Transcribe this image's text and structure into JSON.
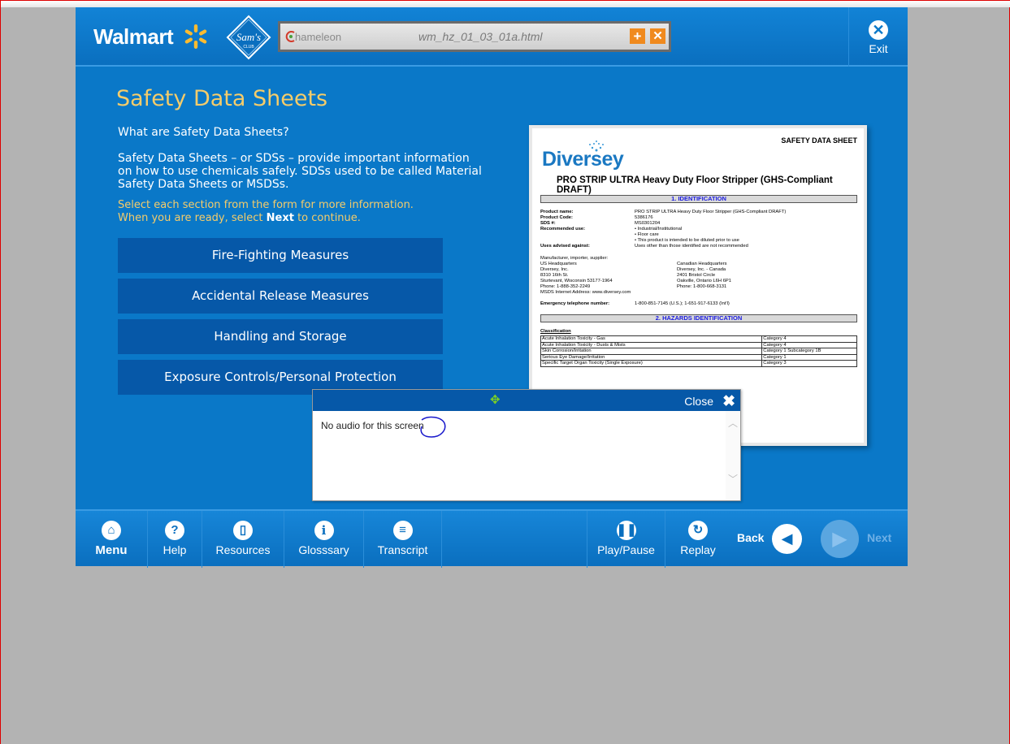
{
  "header": {
    "walmart": "Walmart",
    "sams": "Sam's",
    "sams_sub": "CLUB",
    "chameleon": "hameleon",
    "filename": "wm_hz_01_03_01a.html",
    "exit_label": "Exit"
  },
  "content": {
    "title": "Safety Data Sheets",
    "question": "What are Safety Data Sheets?",
    "intro": "Safety Data Sheets – or SDSs – provide important information on how to use chemicals safely.  SDSs used to be called Material Safety Data Sheets or MSDSs.",
    "instr_line1": "Select each section from the form for more information.",
    "instr_line2_pre": "When you are ready, select ",
    "instr_next": "Next",
    "instr_line2_post": " to continue.",
    "sections": [
      "Fire-Fighting Measures",
      "Accidental Release Measures",
      "Handling and Storage",
      "Exposure Controls/Personal Protection"
    ]
  },
  "sds": {
    "header": "SAFETY DATA SHEET",
    "brand": "Diversey",
    "product": "PRO STRIP ULTRA Heavy Duty Floor Stripper (GHS-Compliant DRAFT)",
    "section1": "1. IDENTIFICATION",
    "ident_labels": "Product name:\nProduct Code:\nSDS #:\nRecommended use:\n\n\nUses advised against:",
    "ident_values": "PRO STRIP ULTRA Heavy Duty Floor Stripper (GHS-Compliant DRAFT)\n5386176\nMS0301204\n• Industrial/Institutional\n• Floor care\n• This product is intended to be diluted prior to use\nUses other than those identified are not recommended",
    "us_hq": "Manufacturer, importer, supplier:\nUS Headquarters\nDiversey, Inc.\n8310 16th St.\nSturtevant, Wisconsin 53177-1964\nPhone: 1-888-352-2249\nMSDS Internet Address: www.diversey.com",
    "ca_hq": "\nCanadian Headquarters\nDiversey, Inc. - Canada\n2401 Bristol Circle\nOakville, Ontario L6H 6P1\nPhone: 1-800-668-3131",
    "emergency_label": "Emergency telephone number:",
    "emergency_value": "1-800-851-7145 (U.S.); 1-651-917-6133 (Int'l)",
    "section2": "2. HAZARDS IDENTIFICATION",
    "classification": "Classification",
    "hazards": [
      {
        "name": "Acute Inhalation Toxicity - Gas",
        "cat": "Category 4"
      },
      {
        "name": "Acute Inhalation Toxicity - Dusts & Mists",
        "cat": "Category 4"
      },
      {
        "name": "Skin Corrosion/Irritation",
        "cat": "Category 1 Subcategory 1B"
      },
      {
        "name": "Serious Eye Damage/Irritation",
        "cat": "Category 1"
      },
      {
        "name": "Specific Target Organ Toxicity (Single Exposure)",
        "cat": "Category 3"
      }
    ]
  },
  "popup": {
    "close_label": "Close",
    "text": "No audio for this screen"
  },
  "footer": {
    "menu": "Menu",
    "help": "Help",
    "resources": "Resources",
    "glossary": "Glosssary",
    "transcript": "Transcript",
    "playpause": "Play/Pause",
    "replay": "Replay",
    "back": "Back",
    "next": "Next"
  }
}
